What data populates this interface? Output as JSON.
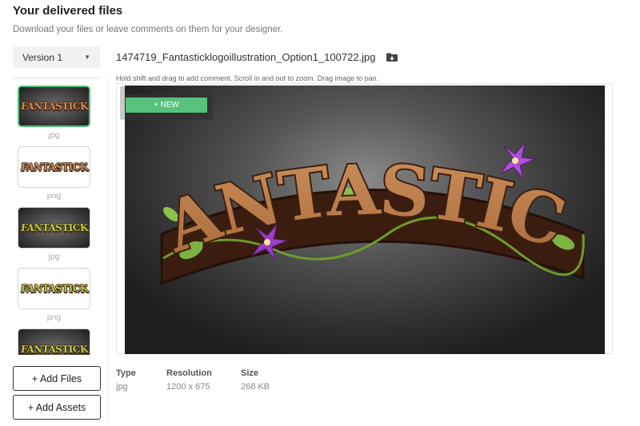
{
  "header": {
    "title": "Your delivered files",
    "subtitle": "Download your files or leave comments on them for your designer."
  },
  "sidebar": {
    "version": "Version 1",
    "thumbnails": [
      {
        "text": "FANTASTICK",
        "type": "jpg"
      },
      {
        "text": "FANTASTICK",
        "type": "png"
      },
      {
        "text": "FANTASTICK",
        "type": "jpg"
      },
      {
        "text": "FANTASTICK",
        "type": "png"
      },
      {
        "text": "FANTASTICK",
        "type": ""
      }
    ],
    "add_files": "+ Add Files",
    "add_assets": "+ Add Assets"
  },
  "viewer": {
    "file_name": "1474719_Fantasticklogoillustration_Option1_100722.jpg",
    "hint": "Hold shift and drag to add comment. Scroll in and out to zoom. Drag image to pan.",
    "new_button": "+ NEW",
    "logo_text": "FANTASTICK"
  },
  "meta": {
    "type_label": "Type",
    "type_value": "jpg",
    "resolution_label": "Resolution",
    "resolution_value": "1200 x 675",
    "size_label": "Size",
    "size_value": "268 KB"
  },
  "colors": {
    "accent": "#56c27c",
    "logo_fill": "#c98d57",
    "logo_outline": "#3d1f10",
    "flower": "#9a3fc4",
    "leaf": "#7cb342"
  }
}
